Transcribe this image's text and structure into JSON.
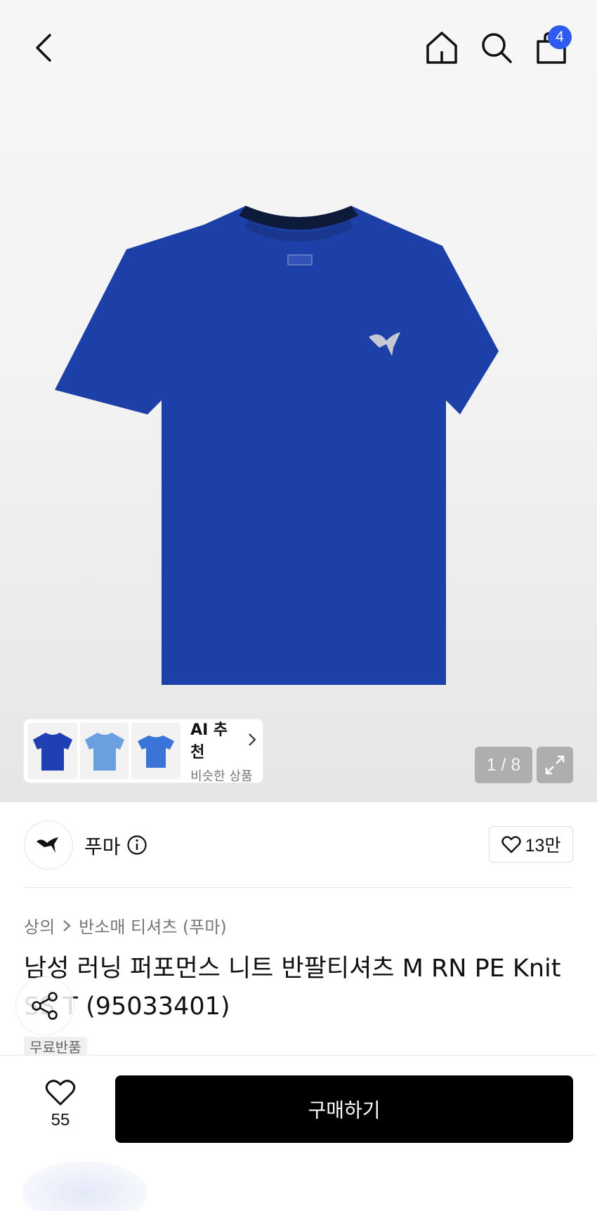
{
  "header": {
    "cart_count": "4",
    "icons": [
      "back-icon",
      "home-icon",
      "search-icon",
      "cart-icon"
    ]
  },
  "gallery": {
    "page_indicator": "1 / 8",
    "ai_recommend": {
      "title": "AI 추천",
      "subtitle": "비슷한 상품"
    },
    "thumb_colors": [
      "#1f3fb3",
      "#6aa0e0",
      "#3a74d8"
    ],
    "product_color": "#1d3fa8"
  },
  "brand": {
    "name": "푸마",
    "like_count": "13만"
  },
  "product": {
    "breadcrumb": [
      "상의",
      "반소매 티셔츠 (푸마)"
    ],
    "title": "남성 러닝 퍼포먼스 니트 반팔티셔츠 M RN PE Knit SS T (95033401)",
    "tag": "무료반품"
  },
  "bottom": {
    "wish_count": "55",
    "buy_label": "구매하기"
  }
}
